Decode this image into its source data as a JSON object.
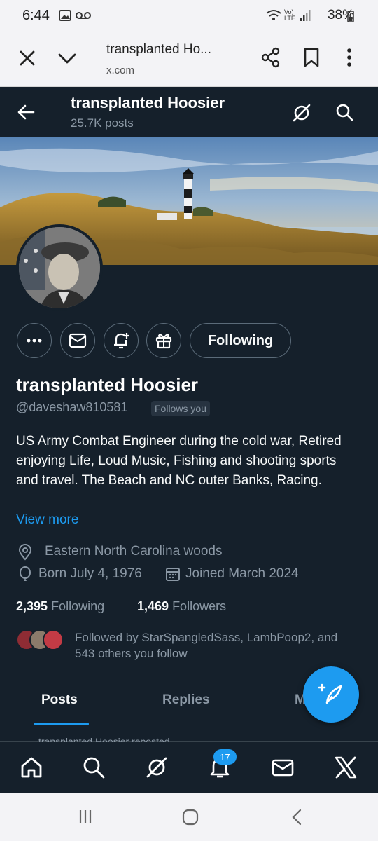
{
  "status_bar": {
    "time": "6:44",
    "network_label": "Vo) LTE",
    "battery": "38%"
  },
  "browser": {
    "page_title": "transplanted Ho...",
    "host": "x.com"
  },
  "header": {
    "title": "transplanted Hoosier",
    "post_count": "25.7K posts"
  },
  "profile": {
    "display_name": "transplanted Hoosier",
    "handle": "@daveshaw810581",
    "follows_you": "Follows you",
    "bio": "US Army Combat Engineer during the cold war, Retired enjoying Life, Loud Music, Fishing and shooting sports and travel.  The Beach and NC outer Banks, Racing.",
    "view_more": "View more",
    "location": "Eastern North Carolina woods",
    "born": "Born July 4, 1976",
    "joined": "Joined March 2024",
    "following_count": "2,395",
    "following_label": "Following",
    "followers_count": "1,469",
    "followers_label": "Followers",
    "followed_by": "Followed by StarSpangledSass, LambPoop2, and 543 others you follow"
  },
  "actions": {
    "following_button": "Following"
  },
  "tabs": [
    {
      "label": "Posts",
      "active": true
    },
    {
      "label": "Replies",
      "active": false
    },
    {
      "label": "M",
      "active": false
    }
  ],
  "timeline_peek": "transplanted Hoosier reposted",
  "bottom_nav": {
    "notifications_badge": "17"
  },
  "colors": {
    "background": "#15202b",
    "accent": "#1d9bf0",
    "secondary_text": "#8b98a5",
    "border": "#38444d"
  },
  "icons": [
    "close-icon",
    "chevron-down-icon",
    "share-icon",
    "bookmark-icon",
    "more-vertical-icon",
    "back-arrow-icon",
    "grok-icon",
    "search-icon",
    "more-horizontal-icon",
    "mail-icon",
    "notification-plus-icon",
    "gift-icon",
    "location-icon",
    "balloon-icon",
    "calendar-icon",
    "compose-icon",
    "home-icon",
    "bell-icon",
    "x-logo-icon"
  ]
}
